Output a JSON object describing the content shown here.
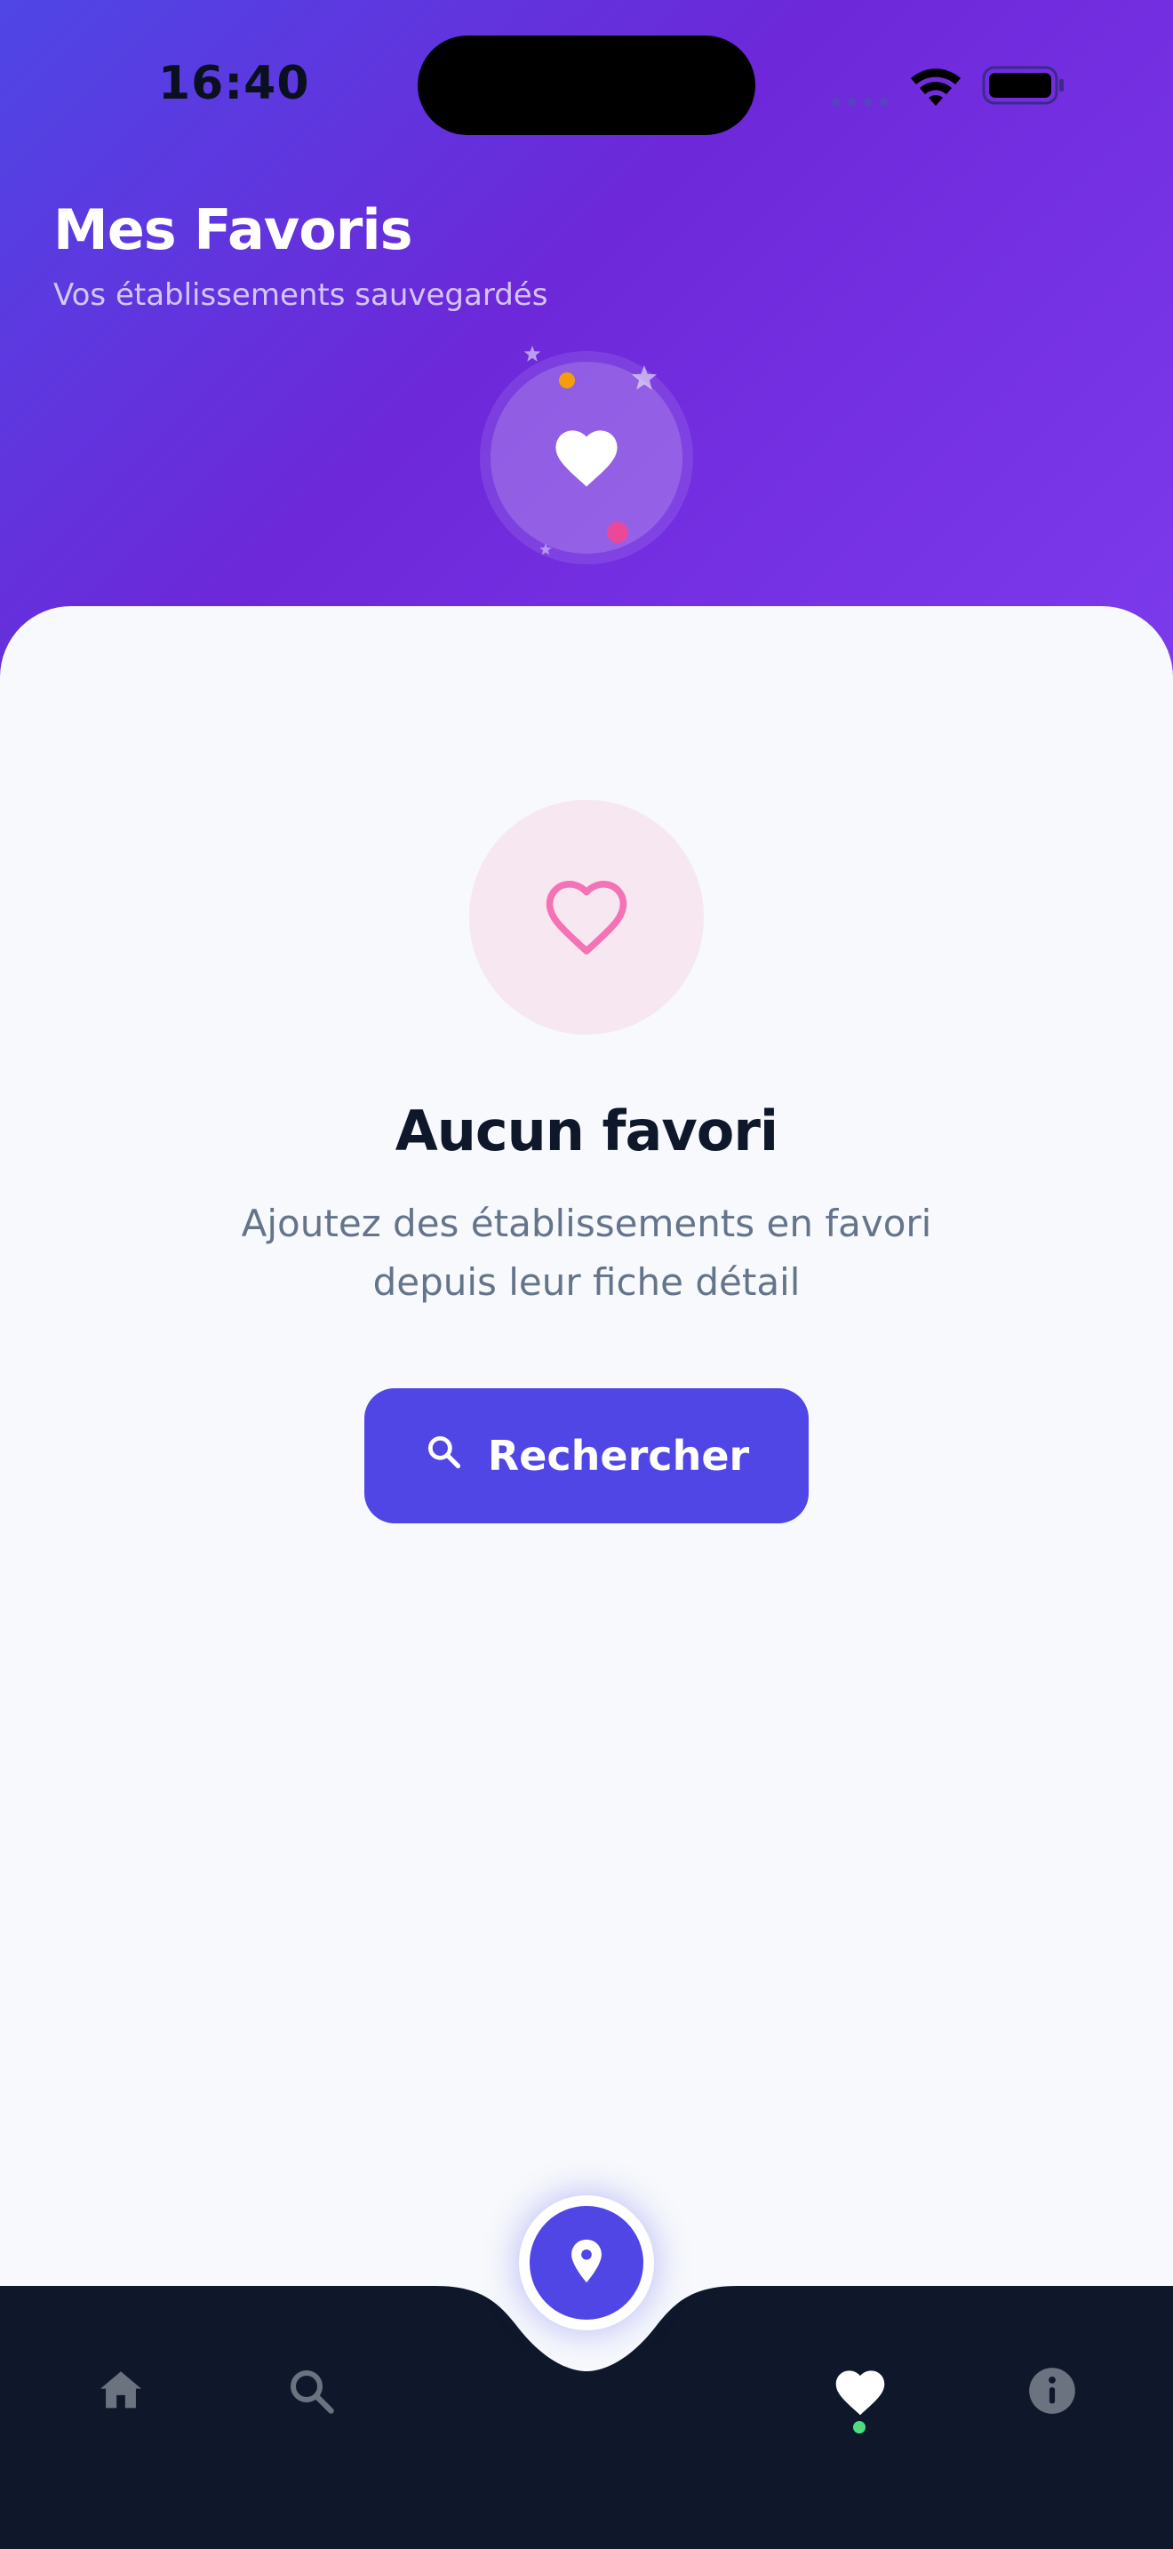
{
  "status_bar": {
    "time": "16:40"
  },
  "header": {
    "title": "Mes Favoris",
    "subtitle": "Vos établissements sauvegardés",
    "hero_icon": "heart-icon"
  },
  "empty_state": {
    "icon": "heart-outline-icon",
    "title": "Aucun favori",
    "description": "Ajoutez des établissements en favori depuis leur fiche détail",
    "button_label": "Rechercher",
    "button_icon": "search-icon"
  },
  "tab_bar": {
    "items": [
      {
        "name": "home",
        "icon": "home-icon",
        "active": false
      },
      {
        "name": "search",
        "icon": "search-icon",
        "active": false
      },
      {
        "name": "map",
        "icon": "location-pin-icon",
        "active": false
      },
      {
        "name": "favorites",
        "icon": "heart-icon",
        "active": true
      },
      {
        "name": "info",
        "icon": "info-icon",
        "active": false
      }
    ]
  },
  "colors": {
    "header_gradient_start": "#4f46e5",
    "header_gradient_end": "#7c3aed",
    "primary": "#4f46e5",
    "tab_bar": "#0f172a",
    "empty_heart": "#f472b6",
    "active_indicator": "#4ade80"
  }
}
